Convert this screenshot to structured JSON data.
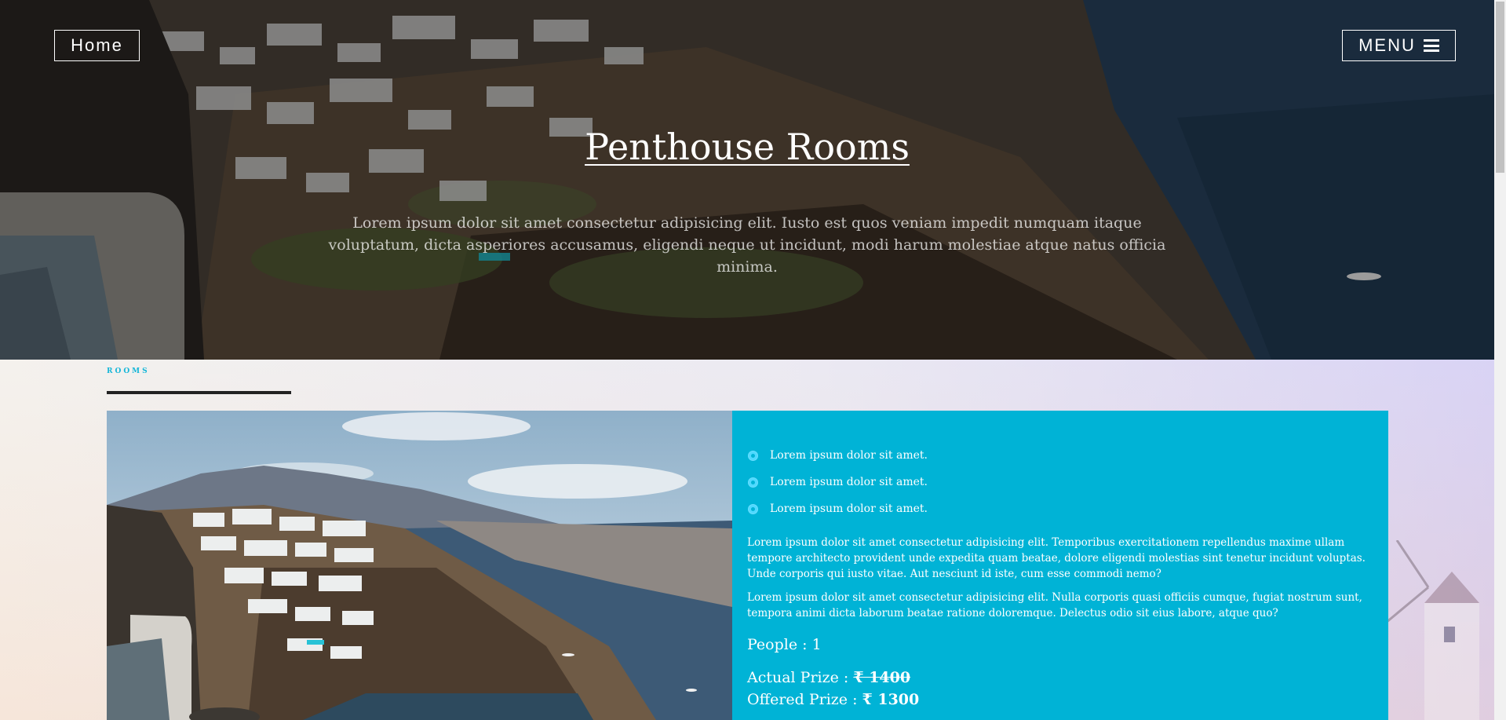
{
  "nav": {
    "home_label": "Home",
    "menu_label": "MENU",
    "menu_icon": "hamburger-icon"
  },
  "hero": {
    "title": "Penthouse Rooms",
    "subtitle": "Lorem ipsum dolor sit amet consectetur adipisicing elit. Iusto est quos veniam impedit numquam itaque voluptatum, dicta asperiores accusamus, eligendi neque ut incidunt, modi harum molestiae atque natus officia minima."
  },
  "section": {
    "label": "ROOMS"
  },
  "room": {
    "features": [
      "Lorem ipsum dolor sit amet.",
      "Lorem ipsum dolor sit amet.",
      "Lorem ipsum dolor sit amet."
    ],
    "paragraph1": "Lorem ipsum dolor sit amet consectetur adipisicing elit. Temporibus exercitationem repellendus maxime ullam tempore architecto provident unde expedita quam beatae, dolore eligendi molestias sint tenetur incidunt voluptas. Unde corporis qui iusto vitae. Aut nesciunt id iste, cum esse commodi nemo?",
    "paragraph2": "Lorem ipsum dolor sit amet consectetur adipisicing elit. Nulla corporis quasi officiis cumque, fugiat nostrum sunt, tempora animi dicta laborum beatae ratione doloremque. Delectus odio sit eius labore, atque quo?",
    "people_label": "People : ",
    "people_value": "1",
    "actual_label": "Actual Prize : ",
    "actual_value": "₹ 1400",
    "offered_label": "Offered Prize : ",
    "offered_value": "₹ 1300"
  },
  "colors": {
    "accent": "#00b3d6",
    "label": "#13b6d8",
    "rule": "#222222"
  }
}
